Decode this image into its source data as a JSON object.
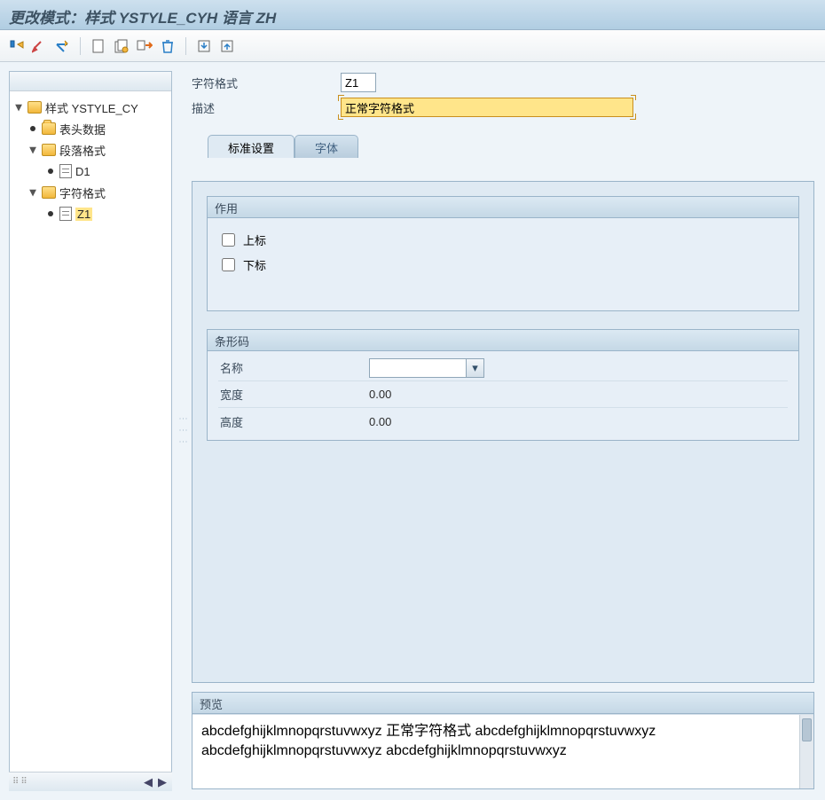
{
  "title": "更改模式：样式 YSTYLE_CYH 语言 ZH",
  "toolbar_icons": [
    "display-toggle-icon",
    "activate-icon",
    "check-icon",
    "sep",
    "create-icon",
    "copy-icon",
    "rename-icon",
    "delete-icon",
    "sep",
    "download-icon",
    "upload-icon"
  ],
  "tree": {
    "root": {
      "label": "样式 YSTYLE_CY"
    },
    "header_data": {
      "label": "表头数据"
    },
    "para_format": {
      "label": "段落格式",
      "children": [
        {
          "id": "D1",
          "label": "D1"
        }
      ]
    },
    "char_format": {
      "label": "字符格式",
      "children": [
        {
          "id": "Z1",
          "label": "Z1",
          "selected": true
        }
      ]
    }
  },
  "form": {
    "char_format_label": "字符格式",
    "char_format_value": "Z1",
    "desc_label": "描述",
    "desc_value": "正常字符格式"
  },
  "tabs": {
    "standard": "标准设置",
    "font": "字体"
  },
  "effects": {
    "group_title": "作用",
    "superscript": "上标",
    "subscript": "下标"
  },
  "barcode": {
    "group_title": "条形码",
    "name_label": "名称",
    "name_value": "",
    "width_label": "宽度",
    "width_value": "0.00",
    "height_label": "高度",
    "height_value": "0.00"
  },
  "preview": {
    "group_title": "预览",
    "line1": "abcdefghijklmnopqrstuvwxyz 正常字符格式 abcdefghijklmnopqrstuvwxyz",
    "line2": "abcdefghijklmnopqrstuvwxyz abcdefghijklmnopqrstuvwxyz"
  }
}
